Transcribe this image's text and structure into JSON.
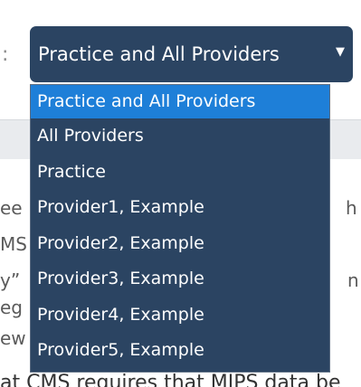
{
  "background": {
    "label_colon": ":",
    "fragments": [
      "ee",
      "MS",
      "y”",
      "eg",
      "ew"
    ],
    "right_fragments": [
      "h",
      "",
      "n",
      "",
      ""
    ],
    "bottom_line": "at CMS requires that MIPS data be"
  },
  "select": {
    "current_value": "Practice and All Providers",
    "caret": "▼",
    "options": [
      {
        "label": "Practice and All Providers",
        "selected": true
      },
      {
        "label": "All Providers",
        "selected": false
      },
      {
        "label": "Practice",
        "selected": false
      },
      {
        "label": "Provider1, Example",
        "selected": false
      },
      {
        "label": "Provider2, Example",
        "selected": false
      },
      {
        "label": "Provider3, Example",
        "selected": false
      },
      {
        "label": "Provider4, Example",
        "selected": false
      },
      {
        "label": "Provider5, Example",
        "selected": false
      }
    ]
  },
  "colors": {
    "dropdown_bg": "#2b4462",
    "selected_option_bg": "#1e7fd8",
    "option_text": "#ffffff"
  }
}
